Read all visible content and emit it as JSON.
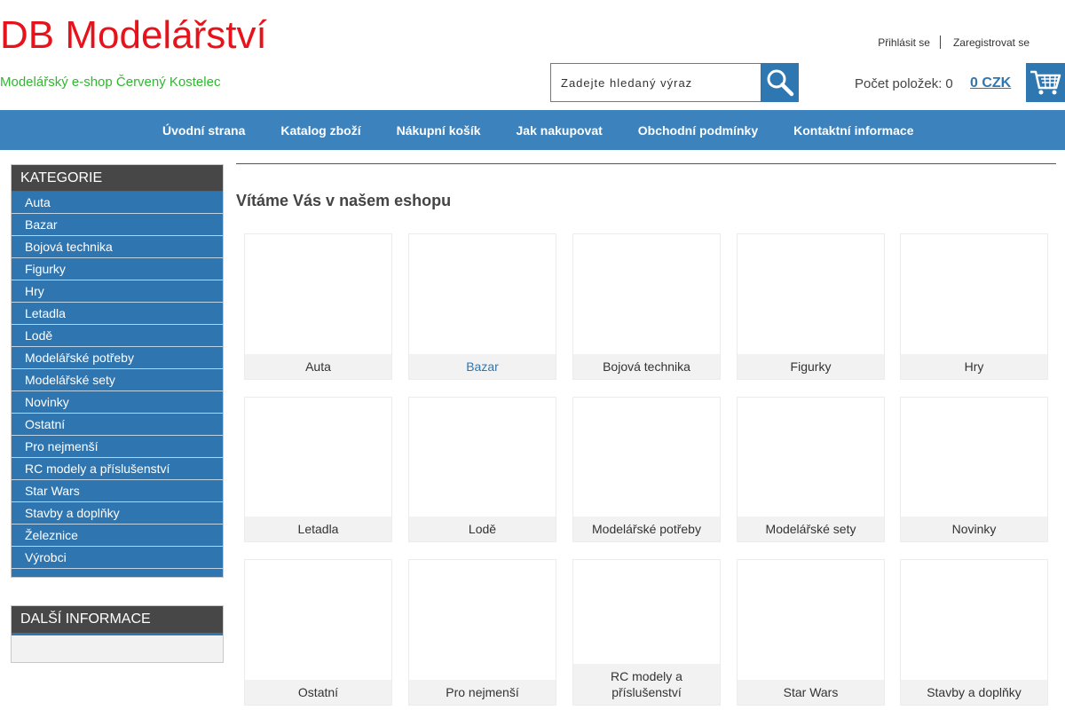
{
  "header": {
    "title": "DB Modelářství",
    "subtitle": "Modelářský e-shop Červený Kostelec",
    "login": "Přihlásit se",
    "register": "Zaregistrovat se",
    "search_placeholder": "Zadejte hledaný výraz",
    "cart_count_label": "Počet položek:",
    "cart_count": "0",
    "cart_total": "0 CZK"
  },
  "nav": [
    "Úvodní strana",
    "Katalog zboží",
    "Nákupní košík",
    "Jak nakupovat",
    "Obchodní podmínky",
    "Kontaktní informace"
  ],
  "sidebar": {
    "categories_title": "KATEGORIE",
    "categories": [
      "Auta",
      "Bazar",
      "Bojová technika",
      "Figurky",
      "Hry",
      "Letadla",
      "Lodě",
      "Modelářské potřeby",
      "Modelářské sety",
      "Novinky",
      "Ostatní",
      "Pro nejmenší",
      "RC modely a příslušenství",
      "Star Wars",
      "Stavby a doplňky",
      "Železnice",
      "Výrobci"
    ],
    "info_title": "DALŠÍ INFORMACE"
  },
  "main": {
    "welcome": "Vítáme Vás v našem eshopu",
    "products": [
      "Auta",
      "Bazar",
      "Bojová technika",
      "Figurky",
      "Hry",
      "Letadla",
      "Lodě",
      "Modelářské potřeby",
      "Modelářské sety",
      "Novinky",
      "Ostatní",
      "Pro nejmenší",
      "RC modely a příslušenství",
      "Star Wars",
      "Stavby a doplňky"
    ],
    "highlighted": "Bazar"
  },
  "colors": {
    "brand_red": "#e8131a",
    "accent_blue": "#2e77b0",
    "subtitle_green": "#2fb82f"
  }
}
